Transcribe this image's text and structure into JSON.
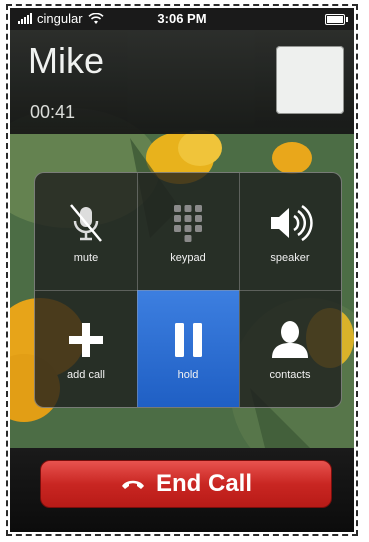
{
  "status_bar": {
    "carrier": "cingular",
    "time": "3:06 PM"
  },
  "call": {
    "caller_name": "Mike",
    "duration": "00:41"
  },
  "controls": [
    {
      "label": "mute",
      "icon": "mute-icon",
      "active": false
    },
    {
      "label": "keypad",
      "icon": "keypad-icon",
      "active": false
    },
    {
      "label": "speaker",
      "icon": "speaker-icon",
      "active": false
    },
    {
      "label": "add call",
      "icon": "add-icon",
      "active": false
    },
    {
      "label": "hold",
      "icon": "pause-icon",
      "active": true
    },
    {
      "label": "contacts",
      "icon": "person-icon",
      "active": false
    }
  ],
  "end_call": {
    "label": "End Call",
    "icon": "phone-hangup-icon",
    "color": "#c92622"
  },
  "colors": {
    "active_button": "#1f5fc4"
  }
}
